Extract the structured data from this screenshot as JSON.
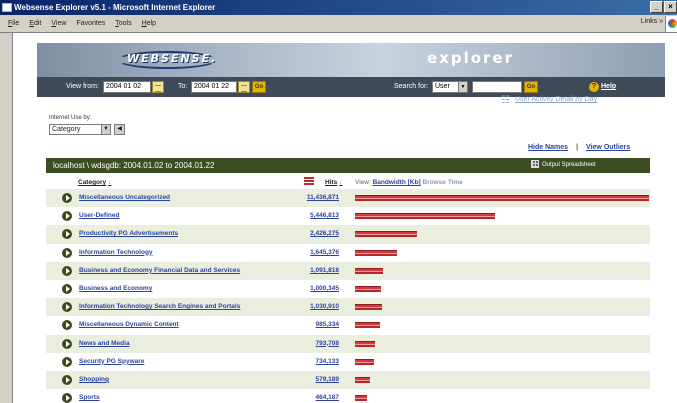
{
  "window": {
    "title": "Websense Explorer v5.1 - Microsoft Internet Explorer",
    "buttons": [
      "_",
      "×"
    ]
  },
  "menu": {
    "items": [
      {
        "ul": "F",
        "rest": "ile"
      },
      {
        "ul": "E",
        "rest": "dit"
      },
      {
        "ul": "V",
        "rest": "iew"
      },
      {
        "ul": "",
        "rest": "Favorites"
      },
      {
        "ul": "T",
        "rest": "ools"
      },
      {
        "ul": "H",
        "rest": "elp"
      }
    ],
    "links_label": "Links",
    "links_chevron": "»"
  },
  "banner": {
    "logo": "WEBSENSE.",
    "product": "explorer"
  },
  "datebar": {
    "view_from_label": "View from:",
    "from_value": "2004 01 02",
    "to_label": "To:",
    "to_value": "2004 01 22",
    "go_label": "Go",
    "search_for_label": "Search for:",
    "search_type": "User",
    "search_value": "",
    "help_symbol": "?",
    "help_label": "Help"
  },
  "activity_link": "User Activity Detail by Day",
  "internet_use_by": {
    "label": "Internet Use by:",
    "selected": "Category"
  },
  "toplinks": {
    "hide_names": "Hide Names",
    "separator": "|",
    "view_outliers": "View Outliers"
  },
  "report": {
    "title": "localhost \\ wdsgdb: 2004.01.02 to 2004.01.22",
    "output_spreadsheet": "Output Spreadsheet"
  },
  "columns": {
    "category": "Category",
    "hits": "Hits",
    "sort_marker": "↓",
    "view_label": "View:",
    "bandwidth": "Bandwidth [Kb]",
    "browse_time": "Browse Time"
  },
  "chart_data": {
    "type": "bar",
    "categories": [
      "Miscellaneous Uncategorized",
      "User-Defined",
      "Productivity PG Advertisements",
      "Information Technology",
      "Business and Economy Financial Data and Services",
      "Business and Economy",
      "Information Technology Search Engines and Portals",
      "Miscellaneous Dynamic Content",
      "News and Media",
      "Security PG Spyware",
      "Shopping",
      "Sports"
    ],
    "labels": [
      "11,436,871",
      "5,446,813",
      "2,426,275",
      "1,645,376",
      "1,091,818",
      "1,000,345",
      "1,030,910",
      "985,334",
      "793,708",
      "734,133",
      "579,189",
      "464,187"
    ],
    "values": [
      11436871,
      5446813,
      2426275,
      1645376,
      1091818,
      1000345,
      1030910,
      985334,
      793708,
      734133,
      579189,
      464187
    ]
  }
}
